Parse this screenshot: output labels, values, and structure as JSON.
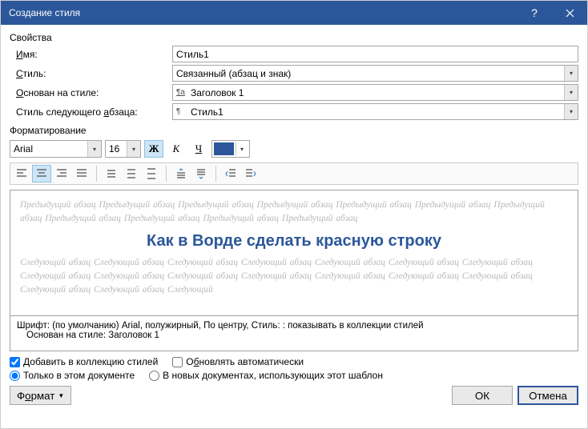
{
  "titlebar": {
    "title": "Создание стиля"
  },
  "section_props": "Свойства",
  "fields": {
    "name_lbl_pre": "",
    "name_u": "И",
    "name_lbl_post": "мя:",
    "name_value": "Стиль1",
    "style_lbl_pre": "",
    "style_u": "С",
    "style_lbl_post": "тиль:",
    "style_value": "Связанный (абзац и знак)",
    "based_lbl_pre": "",
    "based_u": "О",
    "based_lbl_post": "снован на стиле:",
    "based_value": "Заголовок 1",
    "next_lbl_pre": "Стиль следующего ",
    "next_u": "а",
    "next_lbl_post": "бзаца:",
    "next_value": "Стиль1"
  },
  "section_fmt": "Форматирование",
  "formatting": {
    "font": "Arial",
    "size": "16",
    "bold": "Ж",
    "italic": "К",
    "underline": "Ч"
  },
  "preview": {
    "prev_para": "Предыдущий абзац Предыдущий абзац Предыдущий абзац Предыдущий абзац Предыдущий абзац Предыдущий абзац Предыдущий абзац Предыдущий абзац Предыдущий абзац Предыдущий абзац Предыдущий абзац",
    "sample": "Как в Ворде сделать красную строку",
    "next_para": "Следующий абзац Следующий абзац Следующий абзац Следующий абзац Следующий абзац Следующий абзац Следующий абзац Следующий абзац Следующий абзац Следующий абзац Следующий абзац Следующий абзац Следующий абзац Следующий абзац Следующий абзац Следующий абзац Следующий"
  },
  "desc": {
    "line1": "Шрифт: (по умолчанию) Arial, полужирный, По центру, Стиль: : показывать в коллекции стилей",
    "line2": "Основан на стиле: Заголовок 1"
  },
  "options": {
    "add_u": "Д",
    "add": "обавить в коллекцию стилей",
    "auto_pre": "О",
    "auto_u": "б",
    "auto_post": "новлять автоматически",
    "only_doc": "Только в этом документе",
    "in_new": "В новых документах, использующих этот шаблон"
  },
  "buttons": {
    "format_pre": "Ф",
    "format_u": "о",
    "format_post": "рмат",
    "ok": "ОК",
    "cancel": "Отмена"
  }
}
